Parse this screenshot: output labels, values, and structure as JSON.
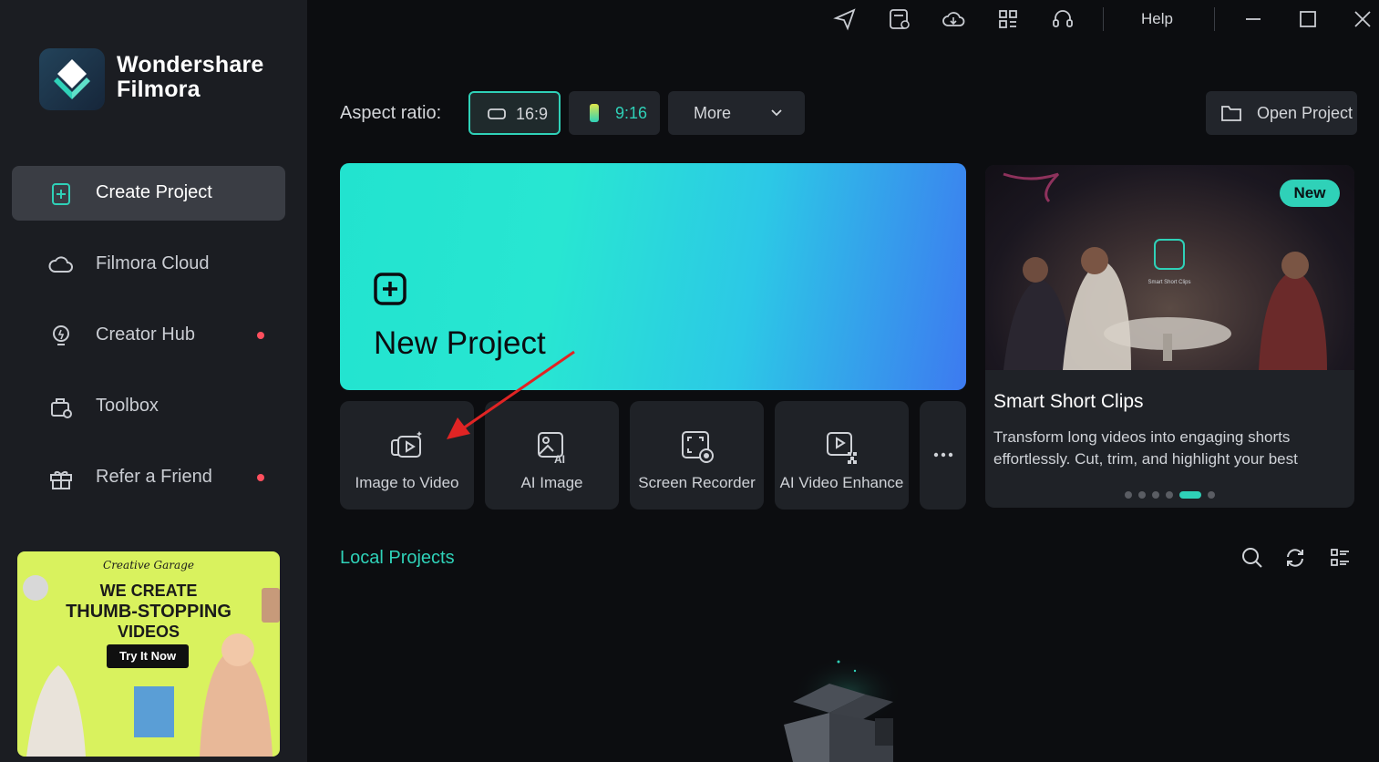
{
  "app": {
    "brand_line1": "Wondershare",
    "brand_line2": "Filmora"
  },
  "sidebar": {
    "items": [
      {
        "label": "Create Project",
        "icon": "plus-square-icon",
        "active": true,
        "dot": false
      },
      {
        "label": "Filmora Cloud",
        "icon": "cloud-icon",
        "active": false,
        "dot": false
      },
      {
        "label": "Creator Hub",
        "icon": "lightbulb-icon",
        "active": false,
        "dot": true
      },
      {
        "label": "Toolbox",
        "icon": "toolbox-icon",
        "active": false,
        "dot": false
      },
      {
        "label": "Refer a Friend",
        "icon": "gift-icon",
        "active": false,
        "dot": true
      }
    ],
    "promo": {
      "script": "Creative Garage",
      "line1": "WE CREATE",
      "line2": "THUMB-STOPPING",
      "line3": "VIDEOS",
      "cta": "Try It Now"
    }
  },
  "titlebar": {
    "help": "Help"
  },
  "aspect": {
    "label": "Aspect ratio:",
    "options": [
      "16:9",
      "9:16"
    ],
    "more": "More",
    "open_project": "Open Project"
  },
  "new_project": {
    "title": "New Project"
  },
  "tools": [
    {
      "label": "Image to Video",
      "icon": "image-to-video-icon"
    },
    {
      "label": "AI Image",
      "icon": "ai-image-icon"
    },
    {
      "label": "Screen Recorder",
      "icon": "screen-recorder-icon"
    },
    {
      "label": "AI Video Enhance",
      "icon": "ai-video-enhance-icon"
    }
  ],
  "feature": {
    "badge": "New",
    "title": "Smart Short Clips",
    "description": "Transform long videos into engaging shorts effortlessly. Cut, trim, and highlight your best",
    "overlay_caption": "Smart Short Clips"
  },
  "local_projects": {
    "title": "Local Projects"
  },
  "colors": {
    "accent": "#2fd1b8",
    "notify_dot": "#ff4f5e",
    "sidebar_bg": "#1b1d22",
    "main_bg": "#0c0d10"
  }
}
